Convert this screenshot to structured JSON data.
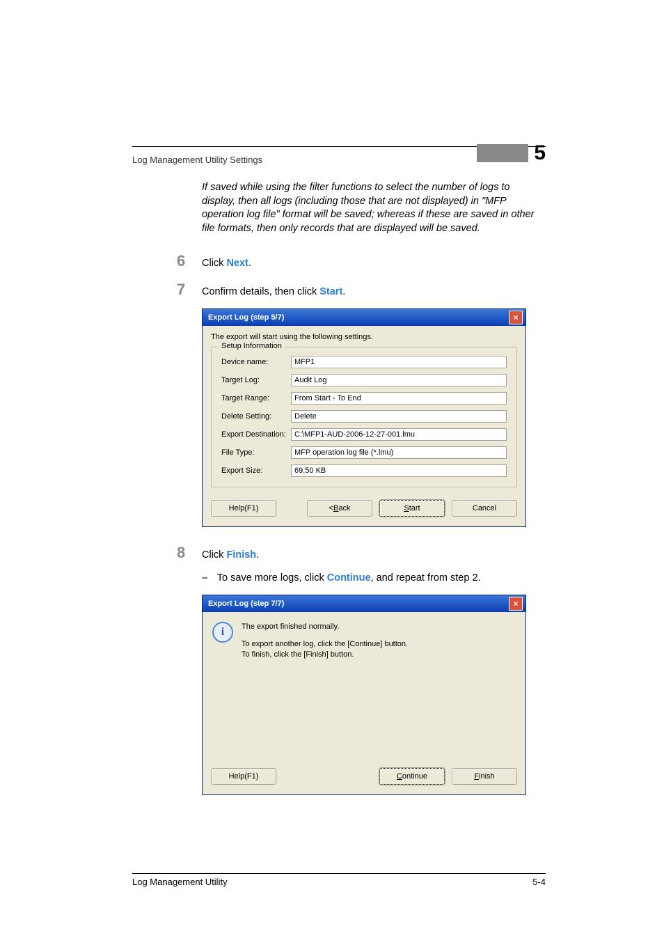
{
  "header": {
    "title": "Log Management Utility Settings",
    "chapter_number": "5"
  },
  "note": "If saved while using the filter functions to select the number of logs to display, then all logs (including those that are not displayed) in \"MFP operation log file\" format will be saved; whereas if these are saved in other file formats, then only records that are displayed will be saved.",
  "steps": {
    "s6": {
      "num": "6",
      "pre": "Click ",
      "kw": "Next",
      "post": "."
    },
    "s7": {
      "num": "7",
      "pre": "Confirm details, then click ",
      "kw": "Start",
      "post": "."
    },
    "s8": {
      "num": "8",
      "pre": "Click ",
      "kw": "Finish",
      "post": "."
    }
  },
  "substep8": {
    "dash": "–",
    "pre": "To save more logs, click ",
    "kw": "Continue",
    "post": ", and repeat from step 2."
  },
  "dlg5": {
    "title": "Export Log (step 5/7)",
    "intro": "The export will start using the following settings.",
    "group_legend": "Setup Information",
    "fields": [
      {
        "label": "Device name:",
        "value": "MFP1"
      },
      {
        "label": "Target Log:",
        "value": "Audit Log"
      },
      {
        "label": "Target Range:",
        "value": "From Start - To End"
      },
      {
        "label": "Delete Setting:",
        "value": "Delete"
      },
      {
        "label": "Export Destination:",
        "value": "C:\\MFP1-AUD-2006-12-27-001.lmu"
      },
      {
        "label": "File Type:",
        "value": "MFP operation log file (*.lmu)"
      },
      {
        "label": "Export Size:",
        "value": "69.50 KB"
      }
    ],
    "buttons": {
      "help": "Help(F1)",
      "back": "< Back",
      "start": "Start",
      "cancel": "Cancel"
    }
  },
  "dlg7": {
    "title": "Export Log (step 7/7)",
    "line1": "The export finished normally.",
    "line2": "To export another log, click the [Continue] button.",
    "line3": "To finish, click the [Finish] button.",
    "buttons": {
      "help": "Help(F1)",
      "continue": "Continue",
      "finish": "Finish"
    }
  },
  "footer": {
    "left": "Log Management Utility",
    "right": "5-4"
  },
  "icons": {
    "close": "×",
    "info": "i"
  }
}
